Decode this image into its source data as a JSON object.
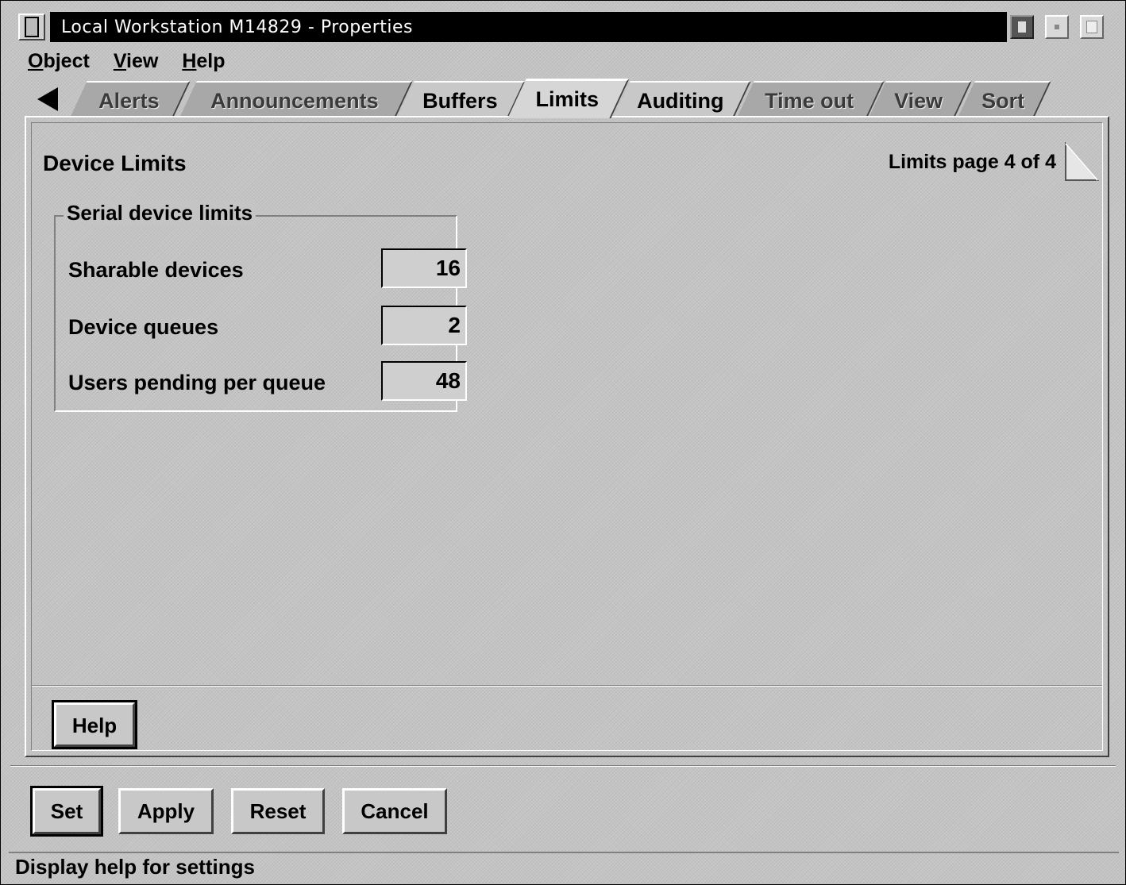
{
  "window": {
    "title": "Local Workstation M14829 - Properties"
  },
  "menubar": {
    "items": [
      {
        "label": "Object",
        "mnemonic": "O",
        "rest": "bject"
      },
      {
        "label": "View",
        "mnemonic": "V",
        "rest": "iew"
      },
      {
        "label": "Help",
        "mnemonic": "H",
        "rest": "elp"
      }
    ]
  },
  "tabs": [
    {
      "label": "Alerts"
    },
    {
      "label": "Announcements"
    },
    {
      "label": "Buffers"
    },
    {
      "label": "Limits",
      "selected": true
    },
    {
      "label": "Auditing"
    },
    {
      "label": "Time out"
    },
    {
      "label": "View"
    },
    {
      "label": "Sort"
    }
  ],
  "page": {
    "title": "Device Limits",
    "page_indicator": "Limits page 4 of 4",
    "group_label": "Serial device limits",
    "fields": [
      {
        "label": "Sharable devices",
        "value": "16"
      },
      {
        "label": "Device queues",
        "value": "2"
      },
      {
        "label": "Users pending per queue",
        "value": "48"
      }
    ],
    "help_button": "Help"
  },
  "buttons": {
    "set": "Set",
    "apply": "Apply",
    "reset": "Reset",
    "cancel": "Cancel"
  },
  "status": {
    "text": "Display help for settings"
  }
}
